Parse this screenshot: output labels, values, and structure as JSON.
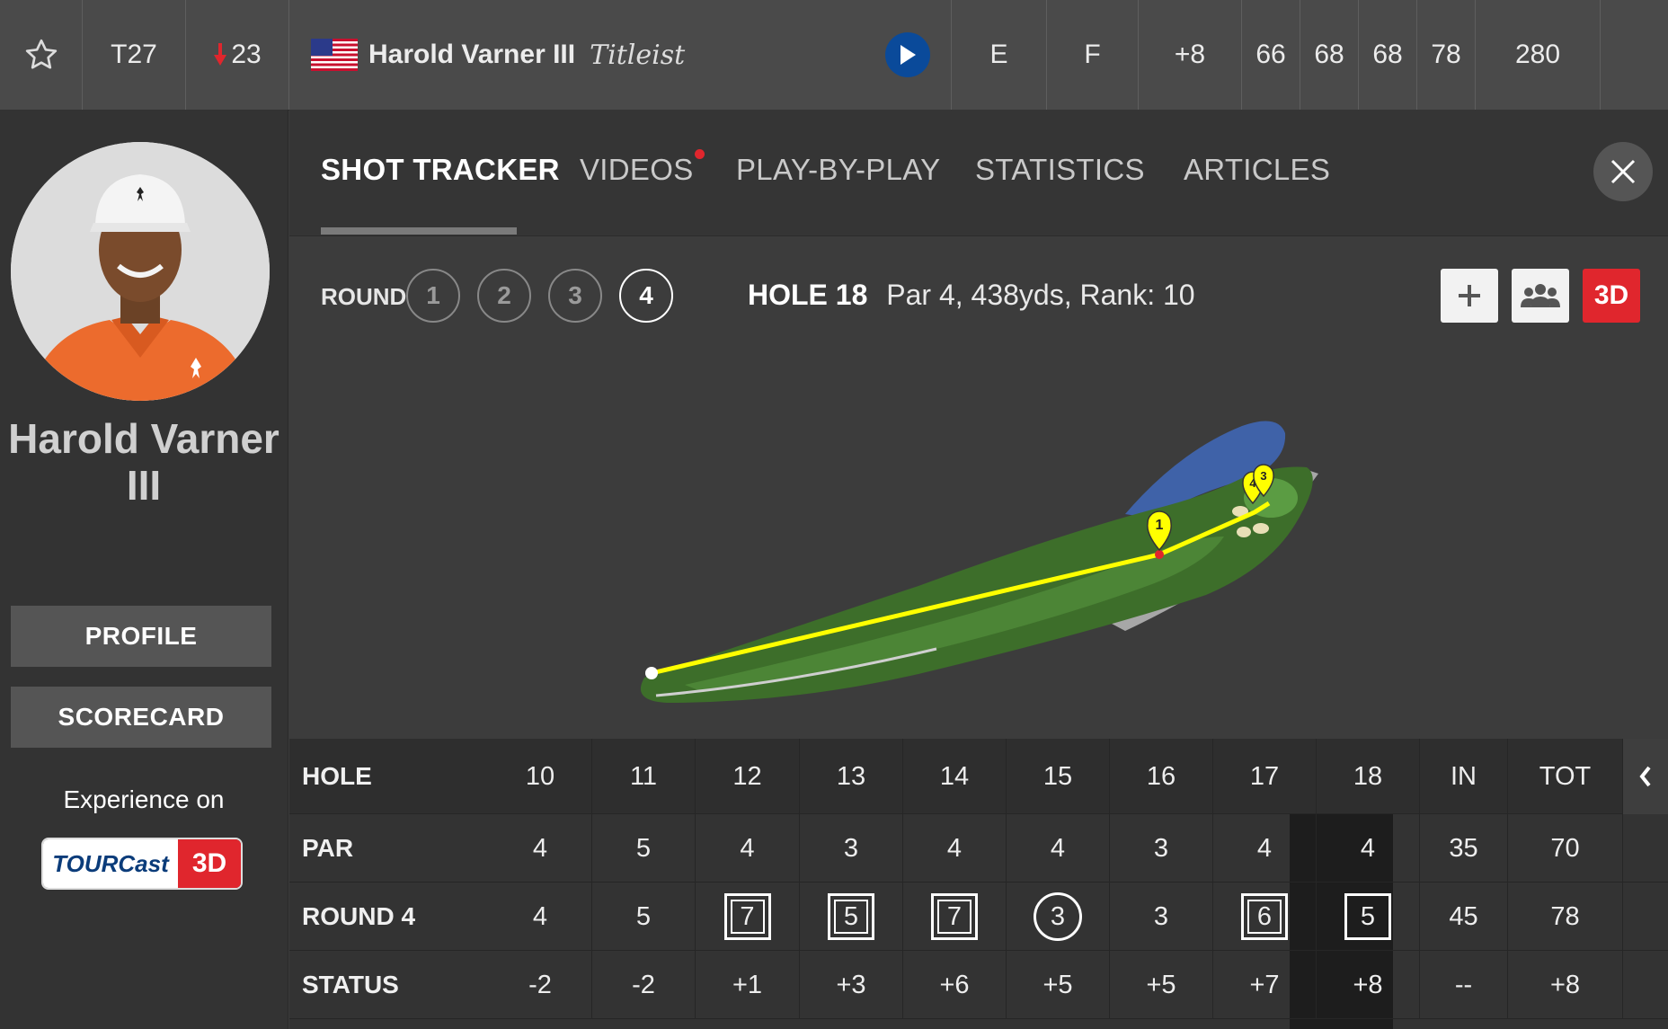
{
  "topbar": {
    "position": "T27",
    "movement": "23",
    "player": "Harold Varner III",
    "sponsor": "Titleist",
    "today": "E",
    "thru": "F",
    "total": "+8",
    "rounds": [
      "66",
      "68",
      "68",
      "78"
    ],
    "strokes": "280"
  },
  "sidebar": {
    "name": "Harold Varner III",
    "profile_label": "PROFILE",
    "scorecard_label": "SCORECARD",
    "experience_label": "Experience on",
    "tourcast_label": "TOURCast",
    "tourcast_3d": "3D"
  },
  "tabs": [
    "SHOT TRACKER",
    "VIDEOS",
    "PLAY-BY-PLAY",
    "STATISTICS",
    "ARTICLES"
  ],
  "round": {
    "label": "ROUND",
    "options": [
      "1",
      "2",
      "3",
      "4"
    ],
    "selected": "4"
  },
  "hole_info": {
    "hole": "HOLE 18",
    "details": "Par 4, 438yds, Rank: 10"
  },
  "tools": {
    "three_d": "3D"
  },
  "shot_markers": [
    "1",
    "4",
    "3"
  ],
  "scorecard": {
    "labels": {
      "hole": "HOLE",
      "par": "PAR",
      "round": "ROUND 4",
      "status": "STATUS"
    },
    "holes": [
      "10",
      "11",
      "12",
      "13",
      "14",
      "15",
      "16",
      "17",
      "18",
      "IN",
      "TOT"
    ],
    "par": [
      "4",
      "5",
      "4",
      "3",
      "4",
      "4",
      "3",
      "4",
      "4",
      "35",
      "70"
    ],
    "round4": [
      "4",
      "5",
      "7",
      "5",
      "7",
      "3",
      "3",
      "6",
      "5",
      "45",
      "78"
    ],
    "status": [
      "-2",
      "-2",
      "+1",
      "+3",
      "+6",
      "+5",
      "+5",
      "+7",
      "+8",
      "--",
      "+8"
    ]
  },
  "colors": {
    "accent_red": "#e0262d",
    "play_blue": "#0a4a9a",
    "fairway": "#3f7a2f",
    "water": "#3f62a8",
    "trace": "#ffff00"
  }
}
